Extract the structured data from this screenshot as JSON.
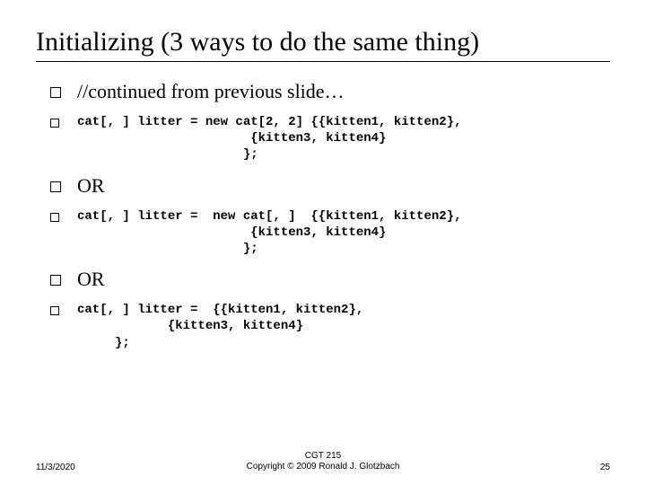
{
  "title": "Initializing (3 ways to do the same thing)",
  "bullets": {
    "b0": "//continued from previous slide…",
    "b1": "cat[, ] litter = new cat[2, 2] {{kitten1, kitten2},\n                       {kitten3, kitten4}\n                      };",
    "b2": "OR",
    "b3": "cat[, ] litter =  new cat[, ]  {{kitten1, kitten2},\n                       {kitten3, kitten4}\n                      };",
    "b4": "OR",
    "b5": "cat[, ] litter =  {{kitten1, kitten2},\n            {kitten3, kitten4}\n     };"
  },
  "footer": {
    "date": "11/3/2020",
    "center1": "CGT 215",
    "center2": "Copyright © 2009 Ronald J. Glotzbach",
    "page": "25"
  }
}
